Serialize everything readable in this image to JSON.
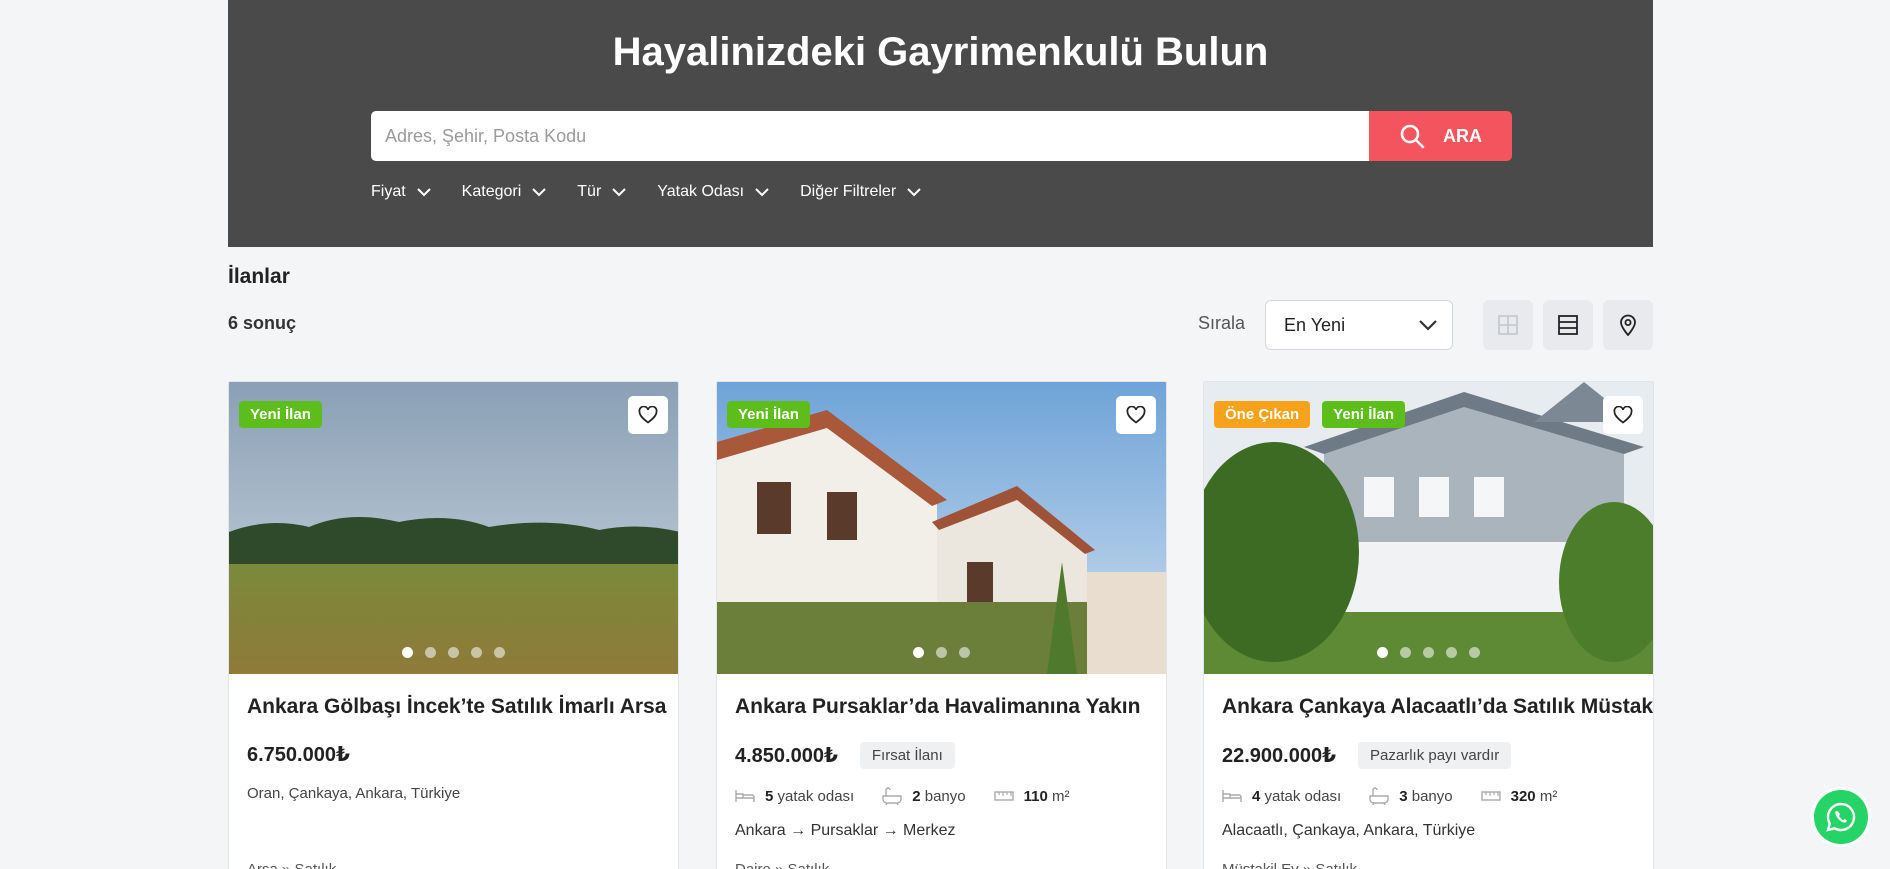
{
  "hero": {
    "title": "Hayalinizdeki Gayrimenkulü Bulun",
    "search_placeholder": "Adres, Şehir, Posta Kodu",
    "search_button": "ARA",
    "filters": [
      "Fiyat",
      "Kategori",
      "Tür",
      "Yatak Odası",
      "Diğer Filtreler"
    ]
  },
  "listing_header": {
    "title": "İlanlar",
    "result_count": "6 sonuç",
    "sort_label": "Sırala",
    "sort_value": "En Yeni"
  },
  "view_icons": [
    "grid-icon",
    "list-icon",
    "map-pin-icon"
  ],
  "listings": [
    {
      "badges": [
        "Yeni İlan"
      ],
      "title": "Ankara Gölbaşı İncek’te Satılık İmarlı Arsa",
      "price": "6.750.000₺",
      "tag": "",
      "bedrooms": "",
      "bathrooms": "",
      "area": "",
      "location": "Oran, Çankaya, Ankara, Türkiye",
      "category": "Arsa » Satılık",
      "image_count": 5,
      "active_image": 1
    },
    {
      "badges": [
        "Yeni İlan"
      ],
      "title": "Ankara Pursaklar’da Havalimanına Yakın",
      "price": "4.850.000₺",
      "tag": "Fırsat İlanı",
      "bedrooms": "5",
      "bedrooms_label": "yatak odası",
      "bathrooms": "2",
      "bathrooms_label": "banyo",
      "area": "110",
      "area_unit": "m²",
      "location": "Ankara → Pursaklar → Merkez",
      "category": "Daire » Satılık",
      "image_count": 3,
      "active_image": 1
    },
    {
      "badges": [
        "Öne Çıkan",
        "Yeni İlan"
      ],
      "title": "Ankara Çankaya Alacaatlı’da Satılık Müstakil",
      "price": "22.900.000₺",
      "tag": "Pazarlık payı vardır",
      "bedrooms": "4",
      "bedrooms_label": "yatak odası",
      "bathrooms": "3",
      "bathrooms_label": "banyo",
      "area": "320",
      "area_unit": "m²",
      "location": "Alacaatlı, Çankaya, Ankara, Türkiye",
      "category": "Müstakil Ev » Satılık",
      "image_count": 5,
      "active_image": 1
    }
  ],
  "colors": {
    "hero_bg": "#4a4a4a",
    "accent": "#f4545d",
    "badge_new": "#5dbe1b",
    "badge_featured": "#f7a21b",
    "whatsapp": "#25d366"
  }
}
